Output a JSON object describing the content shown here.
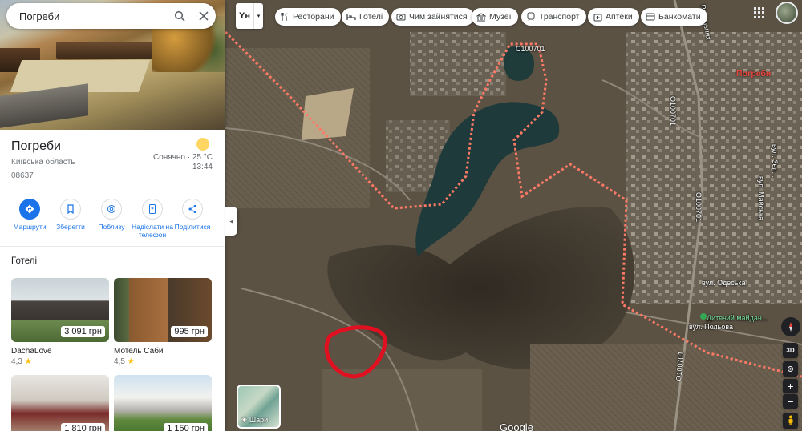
{
  "search": {
    "query": "Погреби"
  },
  "place": {
    "title": "Погреби",
    "region": "Київська область",
    "postcode": "08637",
    "weather": "Сонячно · 25 °C",
    "time": "13:44"
  },
  "actions": [
    {
      "label": "Маршрути",
      "icon": "directions-icon"
    },
    {
      "label": "Зберегти",
      "icon": "bookmark-icon"
    },
    {
      "label": "Поблизу",
      "icon": "nearby-icon"
    },
    {
      "label": "Надіслати на телефон",
      "icon": "send-to-phone-icon"
    },
    {
      "label": "Поділитися",
      "icon": "share-icon"
    }
  ],
  "hotels": {
    "heading": "Готелі",
    "items": [
      {
        "name": "DachaLove",
        "price": "3 091 грн",
        "rating": "4,3"
      },
      {
        "name": "Мотель Саби",
        "price": "995 грн",
        "rating": "4,5"
      },
      {
        "name": "",
        "price": "1 810 грн",
        "rating": ""
      },
      {
        "name": "",
        "price": "1 150 грн",
        "rating": ""
      }
    ]
  },
  "map": {
    "layer_btn": "Yн",
    "chips": [
      {
        "label": "Ресторани",
        "icon": "restaurant-icon"
      },
      {
        "label": "Готелі",
        "icon": "hotel-icon"
      },
      {
        "label": "Чим зайнятися",
        "icon": "camera-icon"
      },
      {
        "label": "Музеї",
        "icon": "museum-icon"
      },
      {
        "label": "Транспорт",
        "icon": "transit-icon"
      },
      {
        "label": "Аптеки",
        "icon": "pharmacy-icon"
      },
      {
        "label": "Банкомати",
        "icon": "atm-icon"
      }
    ],
    "labels": {
      "place": "Погреби",
      "road1": "С100701",
      "road2": "О100701",
      "road3": "О100701",
      "road4": "О100701",
      "street1": "вул. Одеська",
      "street2": "вул. Польова",
      "street3": "вул. Зел...",
      "street4": "вул. Майська",
      "street5": "Рапельних",
      "poi": "Дитячий майдан..."
    },
    "layers_label": "Шари",
    "control_3d": "3D",
    "logo": "Google",
    "accent_red": "#e8453c",
    "boundary_color": "#ff7a66"
  }
}
